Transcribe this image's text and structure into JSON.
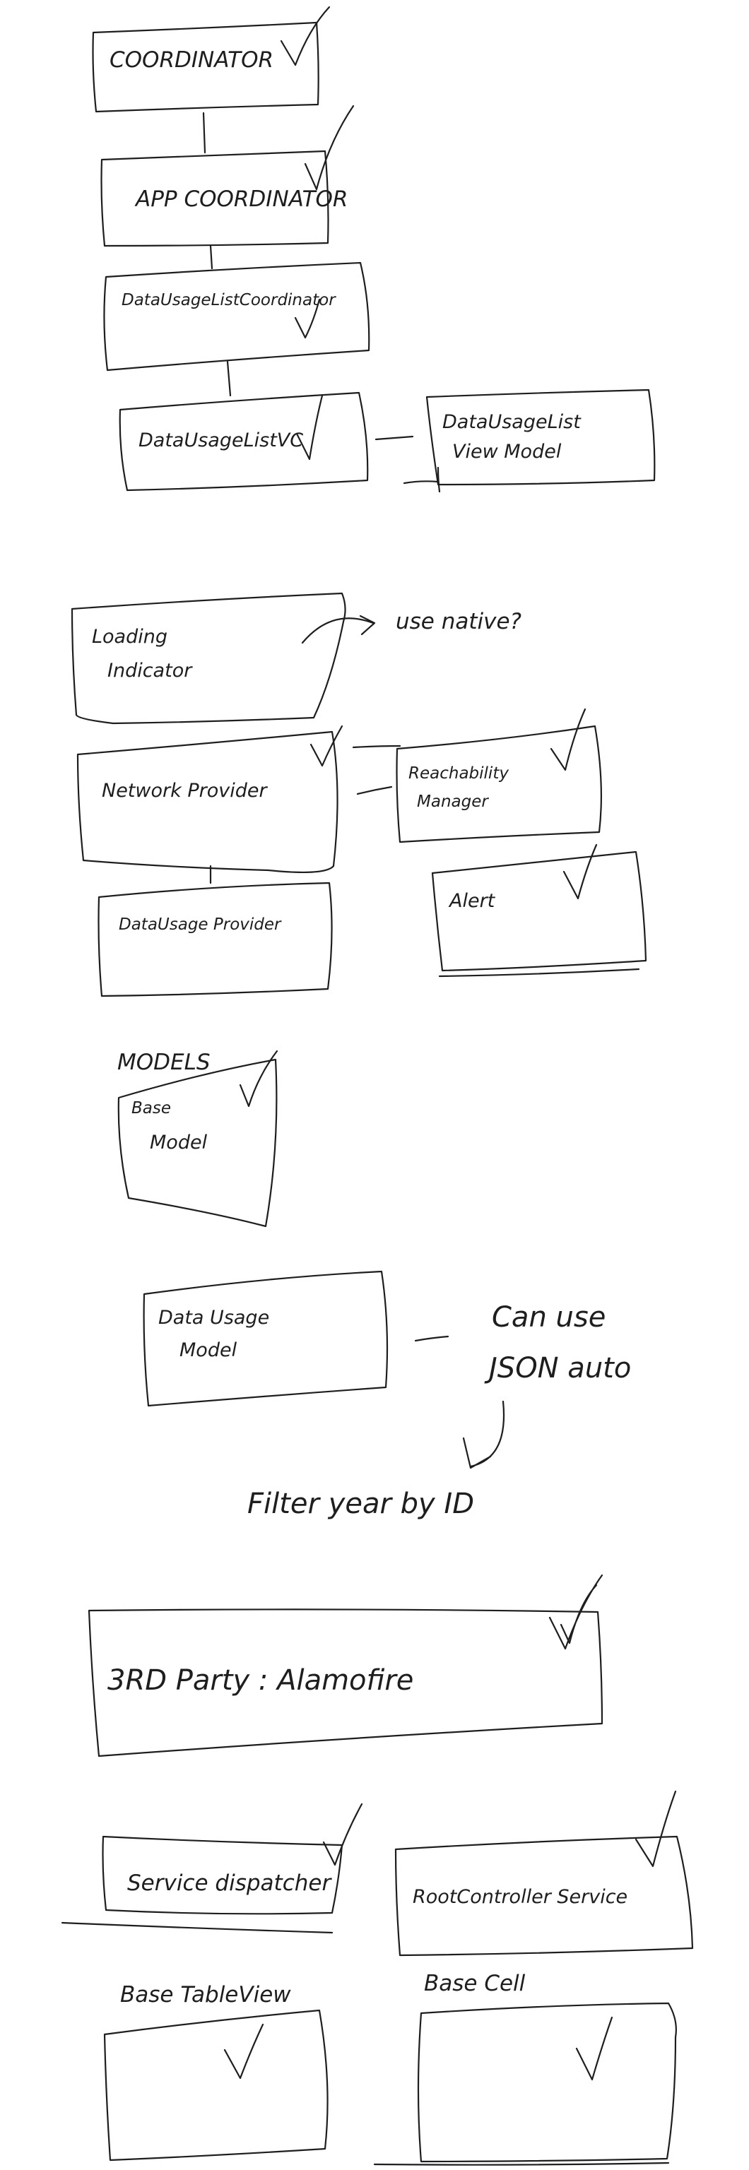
{
  "diagram": {
    "nodes": [
      {
        "id": "coordinator",
        "lines": [
          "COORDINATOR"
        ],
        "checked": true
      },
      {
        "id": "app-coordinator",
        "lines": [
          "APP COORDINATOR"
        ],
        "checked": true
      },
      {
        "id": "data-usage-list-coordinator",
        "lines": [
          "DataUsageListCoordinator"
        ],
        "checked": true
      },
      {
        "id": "data-usage-list-vc",
        "lines": [
          "DataUsageListVC"
        ],
        "checked": true
      },
      {
        "id": "data-usage-list-view-model",
        "lines": [
          "DataUsageList",
          "View Model"
        ],
        "checked": false
      },
      {
        "id": "loading-indicator",
        "lines": [
          "Loading",
          "Indicator"
        ],
        "checked": false
      },
      {
        "id": "network-provider",
        "lines": [
          "Network Provider"
        ],
        "checked": true
      },
      {
        "id": "reachability-manager",
        "lines": [
          "Reachability",
          "Manager"
        ],
        "checked": true
      },
      {
        "id": "data-usage-provider",
        "lines": [
          "DataUsage Provider"
        ],
        "checked": false
      },
      {
        "id": "alert",
        "lines": [
          "Alert"
        ],
        "checked": true
      },
      {
        "id": "base-model",
        "lines": [
          "Base",
          "Model"
        ],
        "checked": true
      },
      {
        "id": "data-usage-model",
        "lines": [
          "Data Usage",
          "Model"
        ],
        "checked": false
      },
      {
        "id": "third-party",
        "lines": [
          "3RD Party : Alamofire"
        ],
        "checked": true
      },
      {
        "id": "service-dispatcher",
        "lines": [
          "Service dispatcher"
        ],
        "checked": true
      },
      {
        "id": "root-controller-service",
        "lines": [
          "RootController Service"
        ],
        "checked": true
      },
      {
        "id": "base-table-view",
        "lines": [
          ""
        ],
        "checked": true
      },
      {
        "id": "base-cell",
        "lines": [
          ""
        ],
        "checked": true
      }
    ],
    "notes": {
      "use_native": "use native?",
      "models_heading": "MODELS",
      "json_line1": "Can use",
      "json_line2": "JSON auto",
      "filter": "Filter year by ID",
      "base_table_view": "Base TableView",
      "base_cell": "Base Cell"
    }
  }
}
